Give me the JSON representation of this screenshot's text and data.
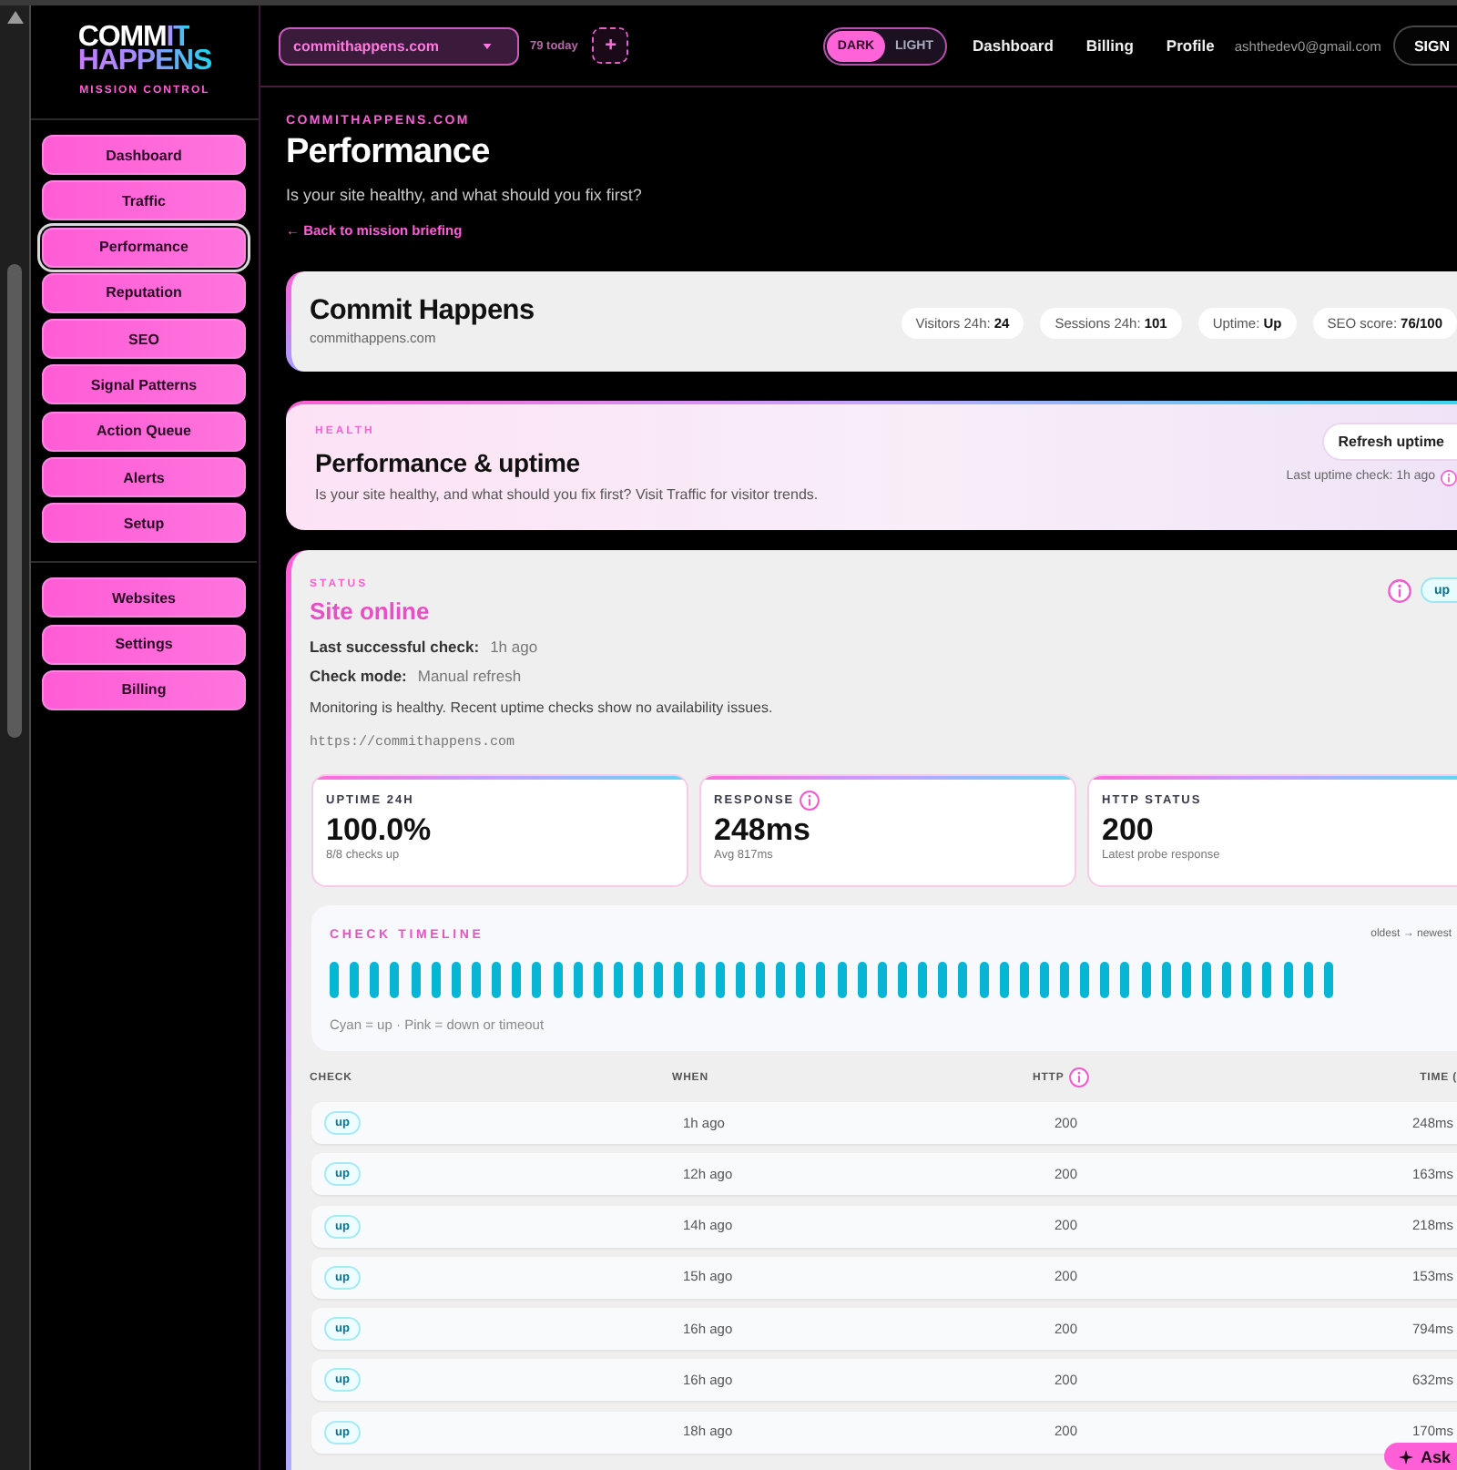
{
  "sidebar": {
    "logo": {
      "text": "COMM",
      "accent": "IT",
      "second_line": "HAPPENS",
      "tagline": "MISSION CONTROL"
    },
    "nav_groups": [
      {
        "items": [
          {
            "label": "Dashboard",
            "selected": false
          },
          {
            "label": "Traffic",
            "selected": false
          },
          {
            "label": "Performance",
            "selected": true
          },
          {
            "label": "Reputation",
            "selected": false
          },
          {
            "label": "SEO",
            "selected": false
          },
          {
            "label": "Signal Patterns",
            "selected": false
          },
          {
            "label": "Action Queue",
            "selected": false
          },
          {
            "label": "Alerts",
            "selected": false
          },
          {
            "label": "Setup",
            "selected": false
          }
        ]
      },
      {
        "items": [
          {
            "label": "Websites",
            "selected": false
          },
          {
            "label": "Settings",
            "selected": false
          },
          {
            "label": "Billing",
            "selected": false
          }
        ]
      }
    ]
  },
  "top_bar": {
    "site_select": {
      "value": "commithappens.com"
    },
    "today_count": "79 today",
    "add_button": "+",
    "theme_toggle": [
      {
        "label": "DARK",
        "selected": true
      },
      {
        "label": "LIGHT",
        "selected": false
      }
    ],
    "links": [
      "Dashboard",
      "Billing",
      "Profile"
    ],
    "email": "ashthedev0@gmail.com",
    "sign_button": "SIGN"
  },
  "page_header": {
    "eyebrow": "COMMITHAPPENS.COM",
    "title": "Performance",
    "subtitle": "Is your site healthy, and what should you fix first?",
    "back_link": "← Back to mission briefing"
  },
  "site_card": {
    "name": "Commit Happens",
    "domain": "commithappens.com",
    "stats": [
      "Visitors 24h: **24**",
      "Sessions 24h: **101**",
      "Uptime: **Up**",
      "SEO score: **76/100**"
    ]
  },
  "health": {
    "eyebrow": "HEALTH",
    "title": "Performance & uptime",
    "subtitle": "Is your site healthy, and what should you fix first? Visit Traffic for visitor trends.",
    "refresh_button": "Refresh uptime",
    "last_check": "Last uptime check: 1h ago"
  },
  "status": {
    "eyebrow": "STATUS",
    "title": "Site online",
    "badge": "up",
    "details": [
      {
        "label": "Last successful check:",
        "value": "1h ago"
      },
      {
        "label": "Check mode:",
        "value": "Manual refresh"
      }
    ],
    "message": "Monitoring is healthy. Recent uptime checks show no availability issues.",
    "url": "https://commithappens.com",
    "metrics": [
      {
        "label": "UPTIME 24H",
        "value": "100.0%",
        "note": "8/8 checks up",
        "info": false
      },
      {
        "label": "RESPONSE",
        "value": "248ms",
        "note": "Avg 817ms",
        "info": true
      },
      {
        "label": "HTTP STATUS",
        "value": "200",
        "note": "Latest probe response",
        "info": false
      }
    ],
    "timeline": {
      "title": "CHECK TIMELINE",
      "direction": "oldest → newest",
      "checks": [
        {
          "up": true
        },
        {
          "up": true
        },
        {
          "up": true
        },
        {
          "up": true
        },
        {
          "up": true
        },
        {
          "up": true
        },
        {
          "up": true
        },
        {
          "up": true
        },
        {
          "up": true
        },
        {
          "up": true
        },
        {
          "up": true
        },
        {
          "up": true
        },
        {
          "up": true
        },
        {
          "up": true
        },
        {
          "up": true
        },
        {
          "up": true
        },
        {
          "up": true
        },
        {
          "up": true
        },
        {
          "up": true
        },
        {
          "up": true
        },
        {
          "up": true
        },
        {
          "up": true
        },
        {
          "up": true
        },
        {
          "up": true
        },
        {
          "up": true
        },
        {
          "up": true
        },
        {
          "up": true
        },
        {
          "up": true
        },
        {
          "up": true
        },
        {
          "up": true
        },
        {
          "up": true
        },
        {
          "up": true
        },
        {
          "up": true
        },
        {
          "up": true
        },
        {
          "up": true
        },
        {
          "up": true
        },
        {
          "up": true
        },
        {
          "up": true
        },
        {
          "up": true
        },
        {
          "up": true
        },
        {
          "up": true
        },
        {
          "up": true
        },
        {
          "up": true
        },
        {
          "up": true
        },
        {
          "up": true
        },
        {
          "up": true
        },
        {
          "up": true
        },
        {
          "up": true
        },
        {
          "up": true
        },
        {
          "up": true
        }
      ],
      "legend": "Cyan = up · Pink = down or timeout"
    },
    "table": {
      "columns": [
        {
          "label": "CHECK",
          "info": false
        },
        {
          "label": "WHEN",
          "info": false
        },
        {
          "label": "HTTP",
          "info": true
        },
        {
          "label": "TIME (",
          "info": false
        }
      ],
      "rows": [
        {
          "check": "up",
          "when": "1h ago",
          "http": "200",
          "time": "248ms"
        },
        {
          "check": "up",
          "when": "12h ago",
          "http": "200",
          "time": "163ms"
        },
        {
          "check": "up",
          "when": "14h ago",
          "http": "200",
          "time": "218ms"
        },
        {
          "check": "up",
          "when": "15h ago",
          "http": "200",
          "time": "153ms"
        },
        {
          "check": "up",
          "when": "16h ago",
          "http": "200",
          "time": "794ms"
        },
        {
          "check": "up",
          "when": "16h ago",
          "http": "200",
          "time": "632ms"
        },
        {
          "check": "up",
          "when": "18h ago",
          "http": "200",
          "time": "170ms"
        }
      ]
    }
  },
  "ask_button": {
    "label": "Ask"
  }
}
